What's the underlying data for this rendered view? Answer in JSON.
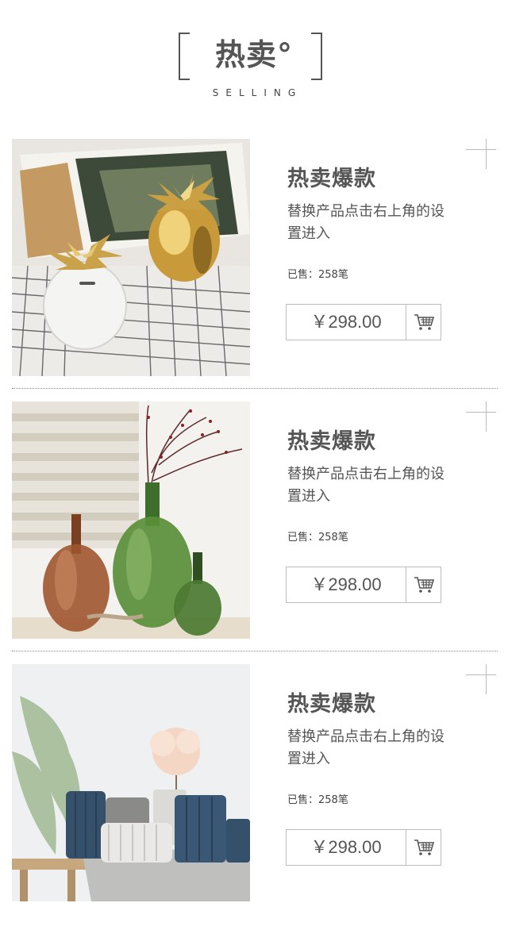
{
  "header": {
    "title": "热卖°",
    "subtitle": "SELLING"
  },
  "products": [
    {
      "name": "热卖爆款",
      "desc": "替换产品点击右上角的设置进入",
      "sold": "已售：258笔",
      "price": "￥298.00",
      "image": "pineapple-ornaments-photo"
    },
    {
      "name": "热卖爆款",
      "desc": "替换产品点击右上角的设置进入",
      "sold": "已售：258笔",
      "price": "￥298.00",
      "image": "glass-vases-photo"
    },
    {
      "name": "热卖爆款",
      "desc": "替换产品点击右上角的设置进入",
      "sold": "已售：258笔",
      "price": "￥298.00",
      "image": "ceramic-vases-photo"
    }
  ],
  "colors": {
    "text": "#555555",
    "border": "#bdbdbd",
    "divider": "#8a8a8a"
  },
  "icons": {
    "cart": "shopping-cart-icon"
  }
}
